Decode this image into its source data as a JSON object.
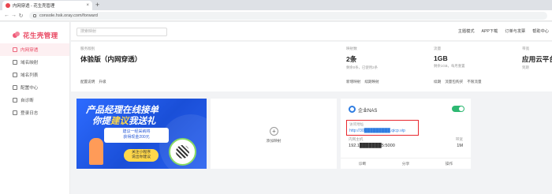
{
  "browser": {
    "tab_title": "内网穿透 - 花生壳管理",
    "tab_close": "×",
    "new_tab": "+",
    "url": "console.hsk.oray.com/forward"
  },
  "sidebar": {
    "logo": "花生壳管理",
    "items": [
      {
        "label": "内网穿透",
        "icon": "network-icon",
        "active": true
      },
      {
        "label": "域名映射",
        "icon": "link-icon",
        "active": false
      },
      {
        "label": "域名列表",
        "icon": "list-icon",
        "active": false
      },
      {
        "label": "配置中心",
        "icon": "gear-icon",
        "active": false
      },
      {
        "label": "自诊断",
        "icon": "diagnose-icon",
        "active": false
      },
      {
        "label": "登录日志",
        "icon": "log-icon",
        "active": false
      }
    ]
  },
  "header": {
    "search_placeholder": "搜索映射",
    "links": [
      "主题模式",
      "APP下载",
      "订单与发票",
      "帮助中心"
    ]
  },
  "stats": {
    "service": {
      "label": "服务版别",
      "value": "体验版（内网穿透）",
      "links": [
        "配置说明",
        "升级"
      ]
    },
    "mappings": {
      "label": "映射数",
      "value": "2条",
      "sub": "剩余0条，已使用2条",
      "links": [
        "新增映射",
        "续期映射"
      ]
    },
    "traffic": {
      "label": "流量",
      "value": "1GB",
      "sub": "剩余1GB，每月重置",
      "links": [
        "续期",
        "流量包购买",
        "不限流量"
      ]
    },
    "cloud": {
      "label": "带宽",
      "value": "应用云平台",
      "sub": "到期"
    }
  },
  "banner": {
    "title_line1": "产品经理在线接单",
    "title_line2_prefix": "你提",
    "title_line2_highlight": "建议",
    "title_line2_suffix": "我送礼",
    "bubble_line1": "建议一经采纳将",
    "bubble_line2": "获得现金200元",
    "tag_line1": "关注小程序",
    "tag_line2": "说出你建议"
  },
  "add_card": {
    "plus": "+",
    "label": "添加映射"
  },
  "device": {
    "name": "企业NAS",
    "enabled": true,
    "address_label": "访问地址",
    "address": "http://30█████████.qicp.vip",
    "host_label": "内网主机",
    "host": "192.1███████5:5000",
    "bandwidth_label": "带宽",
    "bandwidth": "1M",
    "footer": [
      "诊断",
      "分享",
      "操作"
    ]
  },
  "colors": {
    "brand": "#e8455f",
    "link": "#2f7de1",
    "toggle_on": "#2eb872",
    "highlight_box": "#e8282f"
  }
}
